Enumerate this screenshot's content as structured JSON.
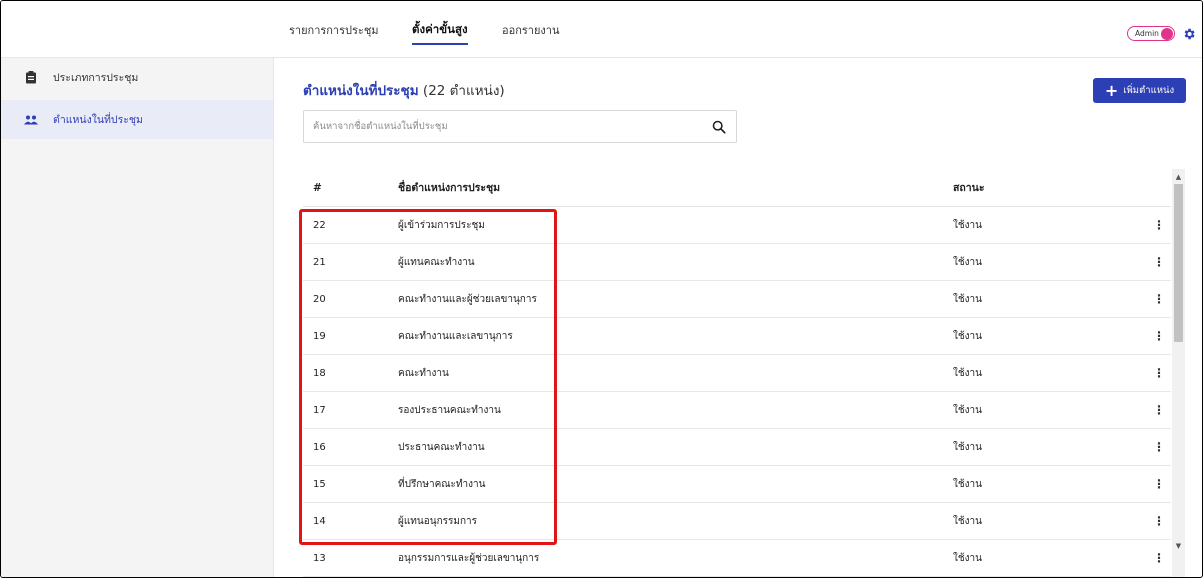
{
  "nav": {
    "tabs": [
      {
        "label": "รายการการประชุม"
      },
      {
        "label": "ตั้งค่าขั้นสูง"
      },
      {
        "label": "ออกรายงาน"
      }
    ],
    "admin_label": "Admin"
  },
  "sidebar": {
    "items": [
      {
        "label": "ประเภทการประชุม",
        "icon": "clipboard-icon"
      },
      {
        "label": "ตำแหน่งในที่ประชุม",
        "icon": "users-icon"
      }
    ]
  },
  "main": {
    "title": "ตำแหน่งในที่ประชุม",
    "count_text": "(22 ตำแหน่ง)",
    "add_button_label": "เพิ่มตำแหน่ง",
    "search_placeholder": "ค้นหาจากชื่อตำแหน่งในที่ประชุม"
  },
  "table": {
    "headers": {
      "num": "#",
      "name": "ชื่อตำแหน่งการประชุม",
      "status": "สถานะ"
    },
    "rows": [
      {
        "num": "22",
        "name": "ผู้เข้าร่วมการประชุม",
        "status": "ใช้งาน"
      },
      {
        "num": "21",
        "name": "ผู้แทนคณะทำงาน",
        "status": "ใช้งาน"
      },
      {
        "num": "20",
        "name": "คณะทำงานและผู้ช่วยเลขานุการ",
        "status": "ใช้งาน"
      },
      {
        "num": "19",
        "name": "คณะทำงานและเลขานุการ",
        "status": "ใช้งาน"
      },
      {
        "num": "18",
        "name": "คณะทำงาน",
        "status": "ใช้งาน"
      },
      {
        "num": "17",
        "name": "รองประธานคณะทำงาน",
        "status": "ใช้งาน"
      },
      {
        "num": "16",
        "name": "ประธานคณะทำงาน",
        "status": "ใช้งาน"
      },
      {
        "num": "15",
        "name": "ที่ปรึกษาคณะทำงาน",
        "status": "ใช้งาน"
      },
      {
        "num": "14",
        "name": "ผู้แทนอนุกรรมการ",
        "status": "ใช้งาน"
      },
      {
        "num": "13",
        "name": "อนุกรรมการและผู้ช่วยเลขานุการ",
        "status": "ใช้งาน"
      }
    ],
    "row_menu_glyph": "⋮"
  },
  "colors": {
    "accent": "#2d3fb4",
    "admin_toggle": "#e0338c",
    "highlight": "#e01616"
  }
}
